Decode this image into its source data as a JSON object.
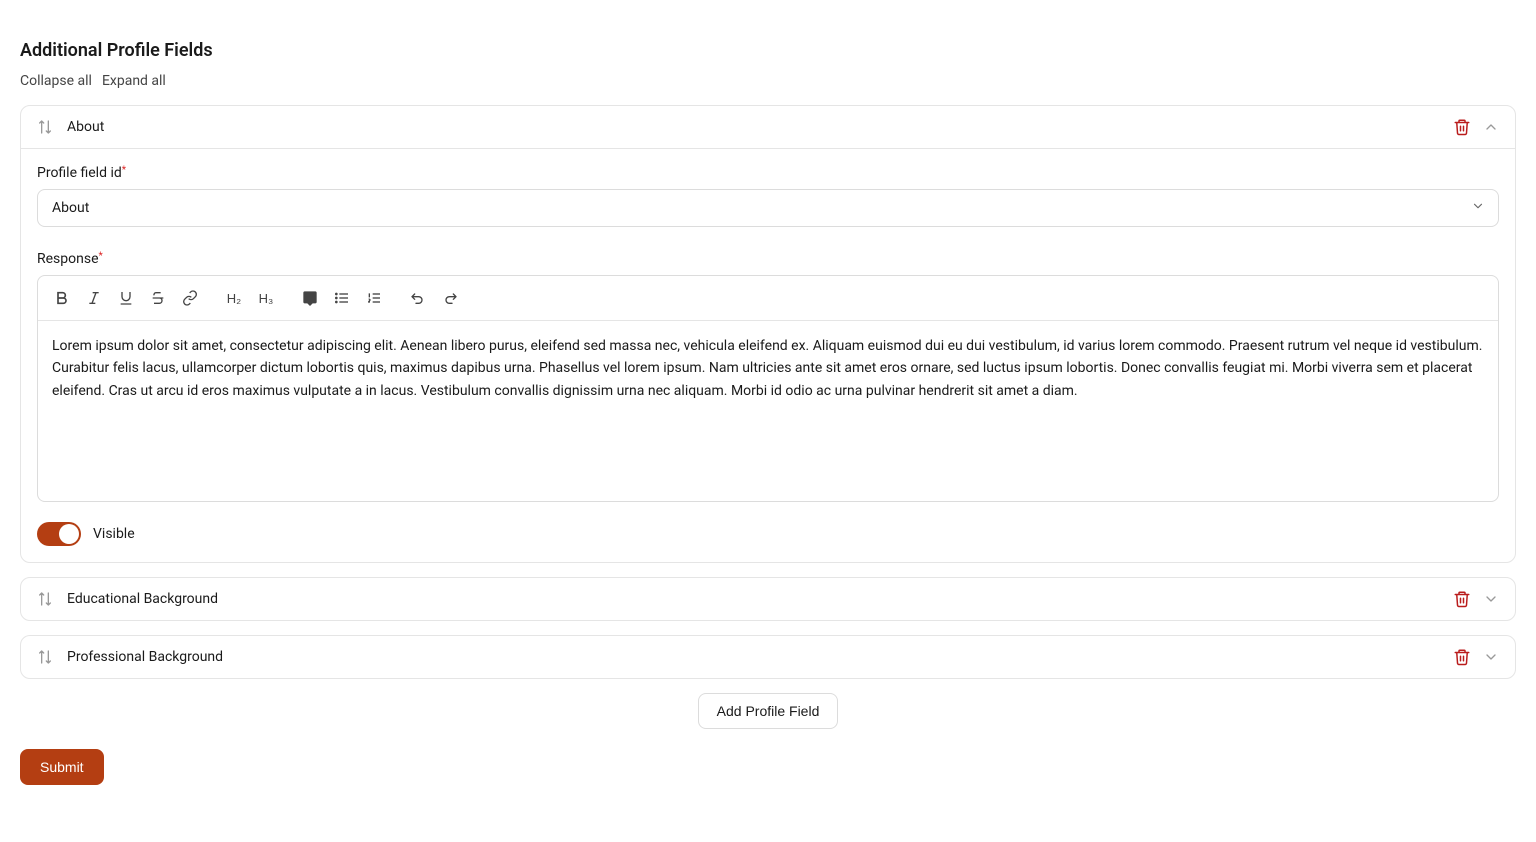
{
  "page": {
    "title": "Additional Profile Fields",
    "collapse_all": "Collapse all",
    "expand_all": "Expand all",
    "add_button": "Add Profile Field",
    "submit_button": "Submit"
  },
  "fields": {
    "about": {
      "title": "About",
      "profile_field_label": "Profile field id",
      "profile_field_value": "About",
      "response_label": "Response",
      "response_text": "Lorem ipsum dolor sit amet, consectetur adipiscing elit. Aenean libero purus, eleifend sed massa nec, vehicula eleifend ex. Aliquam euismod dui eu dui vestibulum, id varius lorem commodo. Praesent rutrum vel neque id vestibulum. Curabitur felis lacus, ullamcorper dictum lobortis quis, maximus dapibus urna. Phasellus vel lorem ipsum. Nam ultricies ante sit amet eros ornare, sed luctus ipsum lobortis. Donec convallis feugiat mi. Morbi viverra sem et placerat eleifend. Cras ut arcu id eros maximus vulputate a in lacus. Vestibulum convallis dignissim urna nec aliquam. Morbi id odio ac urna pulvinar hendrerit sit amet a diam.",
      "visible_label": "Visible"
    },
    "educational": {
      "title": "Educational Background"
    },
    "professional": {
      "title": "Professional Background"
    }
  },
  "toolbar": {
    "h2": "H₂",
    "h3": "H₃"
  }
}
